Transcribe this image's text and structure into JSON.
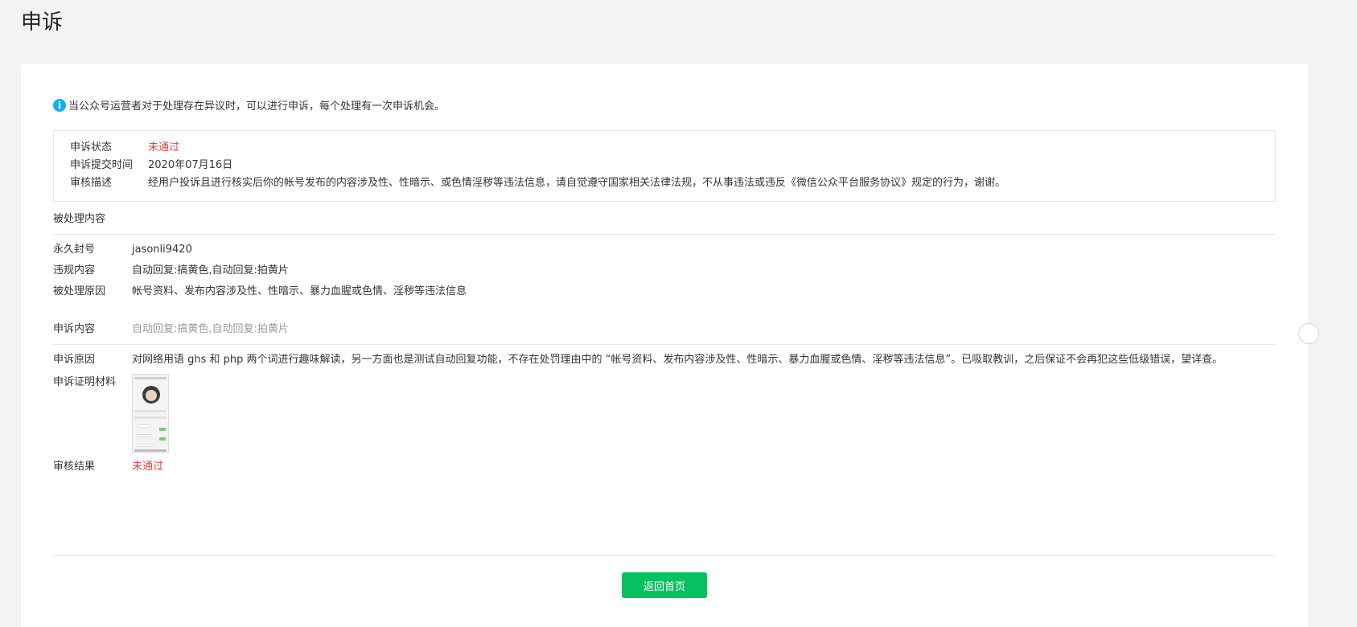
{
  "page": {
    "title": "申诉"
  },
  "notice": {
    "icon": "info-icon",
    "text": "当公众号运营者对于处理存在异议时，可以进行申诉，每个处理有一次申诉机会。"
  },
  "appeal_status": {
    "rows": [
      {
        "label": "申诉状态",
        "value": "未通过"
      },
      {
        "label": "申诉提交时间",
        "value": "2020年07月16日"
      },
      {
        "label": "审核描述",
        "value": "经用户投诉且进行核实后你的帐号发布的内容涉及性、性暗示、或色情淫秽等违法信息，请自觉遵守国家相关法律法规，不从事违法或违反《微信公众平台服务协议》规定的行为，谢谢。"
      }
    ]
  },
  "processed_section": {
    "title": "被处理内容",
    "rows": [
      {
        "label": "永久封号",
        "value": "jasonli9420"
      },
      {
        "label": "违规内容",
        "value": "自动回复:搞黄色,自动回复:拍黄片"
      },
      {
        "label": "被处理原因",
        "value": "帐号资料、发布内容涉及性、性暗示、暴力血腥或色情、淫秽等违法信息"
      }
    ]
  },
  "appeal_section": {
    "label": "申诉内容",
    "value": "自动回复:搞黄色,自动回复:拍黄片",
    "reason_label": "申诉原因",
    "reason_value": "对网络用语 ghs 和 php 两个词进行趣味解读，另一方面也是测试自动回复功能，不存在处罚理由中的 “帐号资料、发布内容涉及性、性暗示、暴力血腥或色情、淫秽等违法信息”。已吸取教训，之后保证不会再犯这些低级错误，望详查。",
    "proof_label": "申诉证明材料",
    "result_label": "审核结果",
    "result_value": "未通过"
  },
  "footer": {
    "back_label": "返回首页"
  },
  "colors": {
    "accent": "#07c160",
    "error": "#e64340",
    "info": "#10aeff"
  }
}
